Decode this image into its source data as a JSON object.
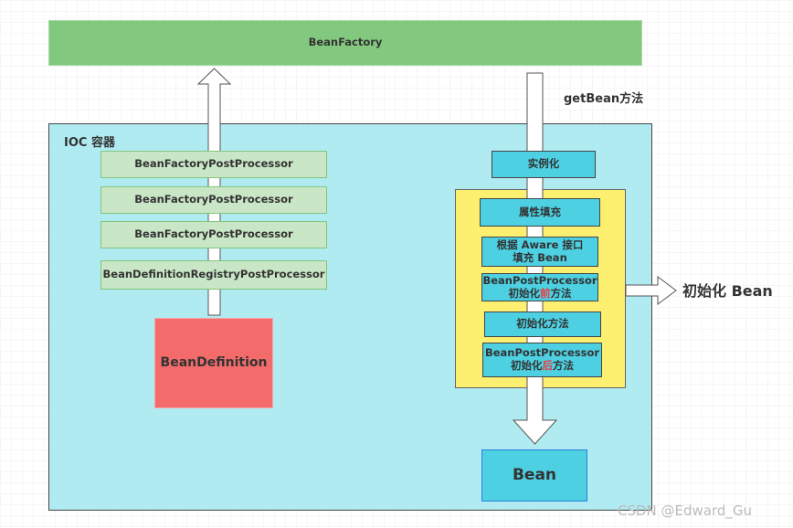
{
  "bean_factory": "BeanFactory",
  "get_bean_label": "getBean方法",
  "ioc_container": "IOC 容器",
  "post_processors": [
    "BeanFactoryPostProcessor",
    "BeanFactoryPostProcessor",
    "BeanFactoryPostProcessor",
    "BeanDefinitionRegistryPostProcessor"
  ],
  "bean_definition": "BeanDefinition",
  "instantiate": "实例化",
  "init_steps": {
    "populate": "属性填充",
    "aware_line1": "根据 Aware 接口",
    "aware_line2": "填充 Bean",
    "bpp_before_line1": "BeanPostProcessor",
    "bpp_before_prefix": "初始化",
    "bpp_before_highlight": "前",
    "bpp_before_suffix": "方法",
    "init_method": "初始化方法",
    "bpp_after_line1": "BeanPostProcessor",
    "bpp_after_prefix": "初始化",
    "bpp_after_highlight": "后",
    "bpp_after_suffix": "方法"
  },
  "init_bean_label": "初始化 Bean",
  "bean": "Bean",
  "watermark": "CSDN @Edward_Gu",
  "colors": {
    "bean_factory": "#82c97f",
    "container": "#b1ebf2",
    "init_group": "#fdef70",
    "bean_definition": "#f46b6b",
    "step": "#4cd0e2",
    "highlight": "#ef3c3c"
  }
}
